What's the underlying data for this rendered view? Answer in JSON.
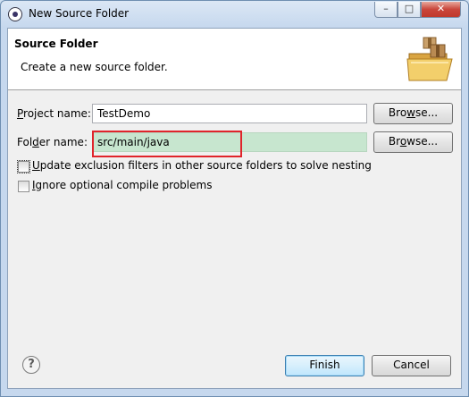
{
  "window": {
    "title": "New Source Folder"
  },
  "banner": {
    "title": "Source Folder",
    "description": "Create a new source folder."
  },
  "project": {
    "label_key": "P",
    "label_rest": "roject name:",
    "value": "TestDemo",
    "browse_pre": "Bro",
    "browse_key": "w",
    "browse_post": "se..."
  },
  "folder": {
    "label_pre": "Fol",
    "label_key": "d",
    "label_post": "er name:",
    "value": "src/main/java",
    "browse_pre": "Br",
    "browse_key": "o",
    "browse_post": "wse..."
  },
  "options": {
    "update_key": "U",
    "update_rest": "pdate exclusion filters in other source folders to solve nesting",
    "ignore_key": "I",
    "ignore_rest": "gnore optional compile problems"
  },
  "footer": {
    "help_symbol": "?",
    "finish_label": "Finish",
    "cancel_label": "Cancel"
  },
  "colors": {
    "highlight": "#e0242b",
    "field_highlight": "#c7e6cf"
  }
}
